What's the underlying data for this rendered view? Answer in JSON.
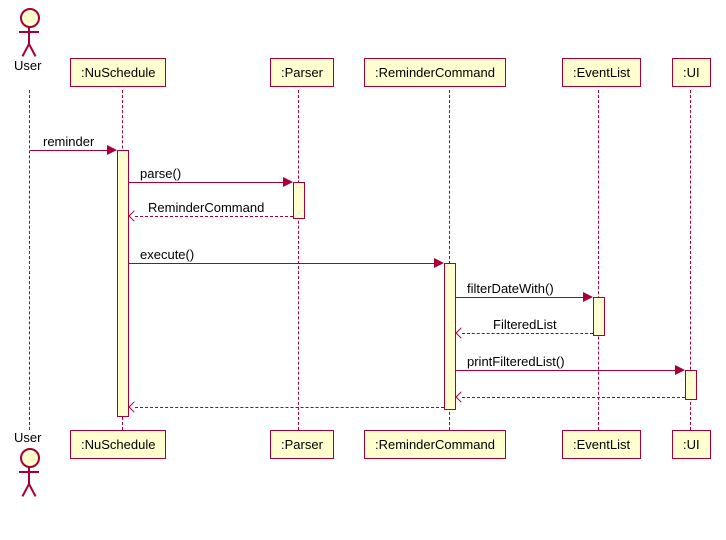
{
  "chart_data": {
    "type": "sequence-diagram",
    "actors": [
      {
        "id": "user",
        "label": "User",
        "kind": "actor"
      },
      {
        "id": "nuschedule",
        "label": ":NuSchedule",
        "kind": "participant"
      },
      {
        "id": "parser",
        "label": ":Parser",
        "kind": "participant"
      },
      {
        "id": "remindercmd",
        "label": ":ReminderCommand",
        "kind": "participant"
      },
      {
        "id": "eventlist",
        "label": ":EventList",
        "kind": "participant"
      },
      {
        "id": "ui",
        "label": ":UI",
        "kind": "participant"
      }
    ],
    "messages": [
      {
        "from": "user",
        "to": "nuschedule",
        "label": "reminder",
        "type": "sync"
      },
      {
        "from": "nuschedule",
        "to": "parser",
        "label": "parse()",
        "type": "sync"
      },
      {
        "from": "parser",
        "to": "nuschedule",
        "label": "ReminderCommand",
        "type": "return"
      },
      {
        "from": "nuschedule",
        "to": "remindercmd",
        "label": "execute()",
        "type": "sync"
      },
      {
        "from": "remindercmd",
        "to": "eventlist",
        "label": "filterDateWith()",
        "type": "sync"
      },
      {
        "from": "eventlist",
        "to": "remindercmd",
        "label": "FilteredList",
        "type": "return"
      },
      {
        "from": "remindercmd",
        "to": "ui",
        "label": "printFilteredList()",
        "type": "sync"
      },
      {
        "from": "ui",
        "to": "remindercmd",
        "label": "",
        "type": "return"
      },
      {
        "from": "remindercmd",
        "to": "nuschedule",
        "label": "",
        "type": "return"
      }
    ]
  },
  "labels": {
    "user": "User",
    "nuschedule": ":NuSchedule",
    "parser": ":Parser",
    "remindercmd": ":ReminderCommand",
    "eventlist": ":EventList",
    "ui": ":UI",
    "msg_reminder": "reminder",
    "msg_parse": "parse()",
    "msg_remindercmd_return": "ReminderCommand",
    "msg_execute": "execute()",
    "msg_filterdate": "filterDateWith()",
    "msg_filteredlist": "FilteredList",
    "msg_printfiltered": "printFilteredList()"
  }
}
